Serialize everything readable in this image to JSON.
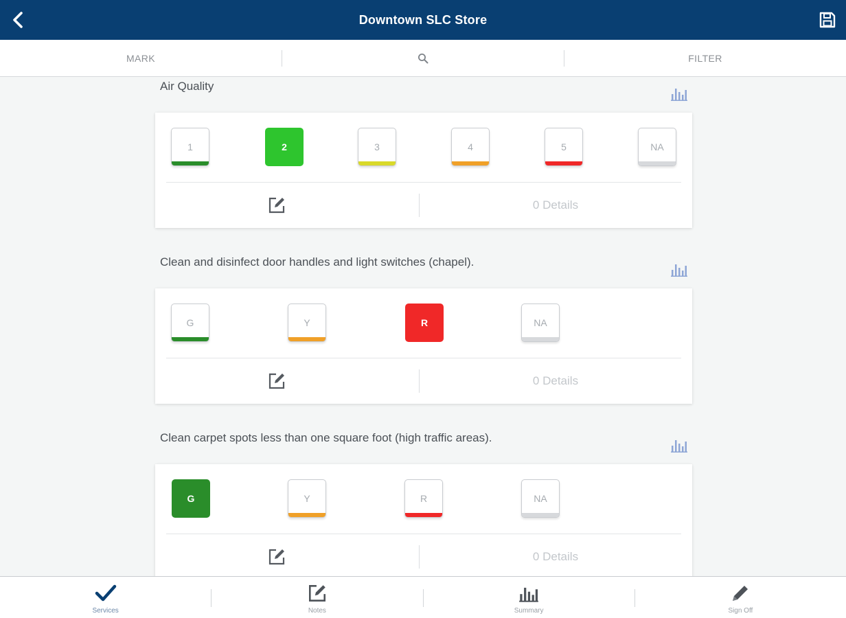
{
  "header": {
    "title": "Downtown SLC Store",
    "back_icon": "chevron-left-icon",
    "save_icon": "floppy-disk-icon",
    "bg_color": "#093f72"
  },
  "toolbar": {
    "mark_label": "MARK",
    "search_icon": "search-icon",
    "filter_label": "FILTER"
  },
  "colors": {
    "green": "#2a8d2a",
    "bright_green": "#2ec52e",
    "yellow": "#d9d92a",
    "orange": "#f0a028",
    "red": "#f02828",
    "gray": "#d7d9dc"
  },
  "questions": [
    {
      "title": "Air Quality",
      "selected": "2",
      "details": "0 Details",
      "buttons": [
        "1",
        "2",
        "3",
        "4",
        "5",
        "NA"
      ]
    },
    {
      "title": "Clean and disinfect door handles and light switches (chapel).",
      "selected": "R",
      "details": "0 Details",
      "buttons": [
        "G",
        "Y",
        "R",
        "NA"
      ]
    },
    {
      "title": "Clean carpet spots less than one square foot (high traffic areas).",
      "selected": "G",
      "details": "0 Details",
      "buttons": [
        "G",
        "Y",
        "R",
        "NA"
      ]
    }
  ],
  "bottom_nav": [
    {
      "label": "Services",
      "icon": "checkmark-icon",
      "active": true
    },
    {
      "label": "Notes",
      "icon": "edit-note-icon",
      "active": false
    },
    {
      "label": "Summary",
      "icon": "bar-chart-icon",
      "active": false
    },
    {
      "label": "Sign Off",
      "icon": "pencil-icon",
      "active": false
    }
  ]
}
